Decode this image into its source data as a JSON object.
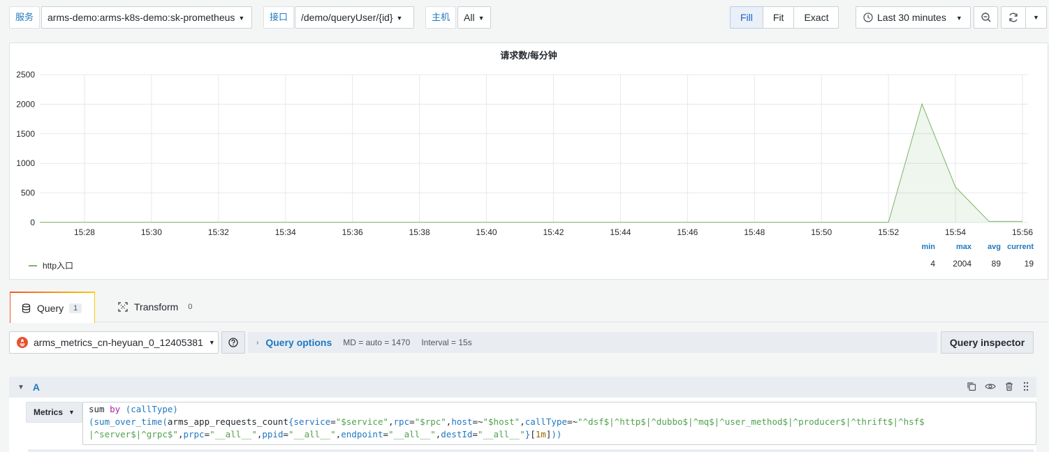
{
  "variables": [
    {
      "label": "服务",
      "value": "arms-demo:arms-k8s-demo:sk-prometheus"
    },
    {
      "label": "接口",
      "value": "/demo/queryUser/{id}"
    },
    {
      "label": "主机",
      "value": "All"
    }
  ],
  "toolbar": {
    "fill": "Fill",
    "fit": "Fit",
    "exact": "Exact",
    "time_range": "Last 30 minutes",
    "zoom_icon": "zoom-out-icon",
    "refresh_icon": "refresh-icon"
  },
  "panel": {
    "title": "请求数/每分钟",
    "legend": {
      "series_name": "http入口",
      "headers": [
        "min",
        "max",
        "avg",
        "current"
      ],
      "values": [
        "4",
        "2004",
        "89",
        "19"
      ]
    }
  },
  "chart_data": {
    "type": "area",
    "title": "请求数/每分钟",
    "x_ticks": [
      "15:28",
      "15:30",
      "15:32",
      "15:34",
      "15:36",
      "15:38",
      "15:40",
      "15:42",
      "15:44",
      "15:46",
      "15:48",
      "15:50",
      "15:52",
      "15:54",
      "15:56"
    ],
    "y_ticks": [
      "0",
      "500",
      "1000",
      "1500",
      "2000",
      "2500"
    ],
    "ylim": [
      0,
      2500
    ],
    "x_range": [
      "15:26:40",
      "15:56:10"
    ],
    "series": [
      {
        "name": "http入口",
        "color": "#7eb26d",
        "points": [
          [
            "15:26:40",
            4
          ],
          [
            "15:52:00",
            4
          ],
          [
            "15:53:00",
            2004
          ],
          [
            "15:54:00",
            600
          ],
          [
            "15:55:00",
            19
          ],
          [
            "15:56:00",
            19
          ]
        ]
      }
    ],
    "grid": true,
    "legend": "bottom"
  },
  "tabs": [
    {
      "label": "Query",
      "count": "1"
    },
    {
      "label": "Transform",
      "count": "0"
    }
  ],
  "query": {
    "datasource": "arms_metrics_cn-heyuan_0_12405381",
    "options_label": "Query options",
    "md": "MD = auto = 1470",
    "interval": "Interval = 15s",
    "inspector": "Query inspector",
    "ref_id": "A",
    "mode": "Metrics"
  },
  "colors": {
    "accent": "#1f78c1",
    "series": "#7eb26d"
  }
}
